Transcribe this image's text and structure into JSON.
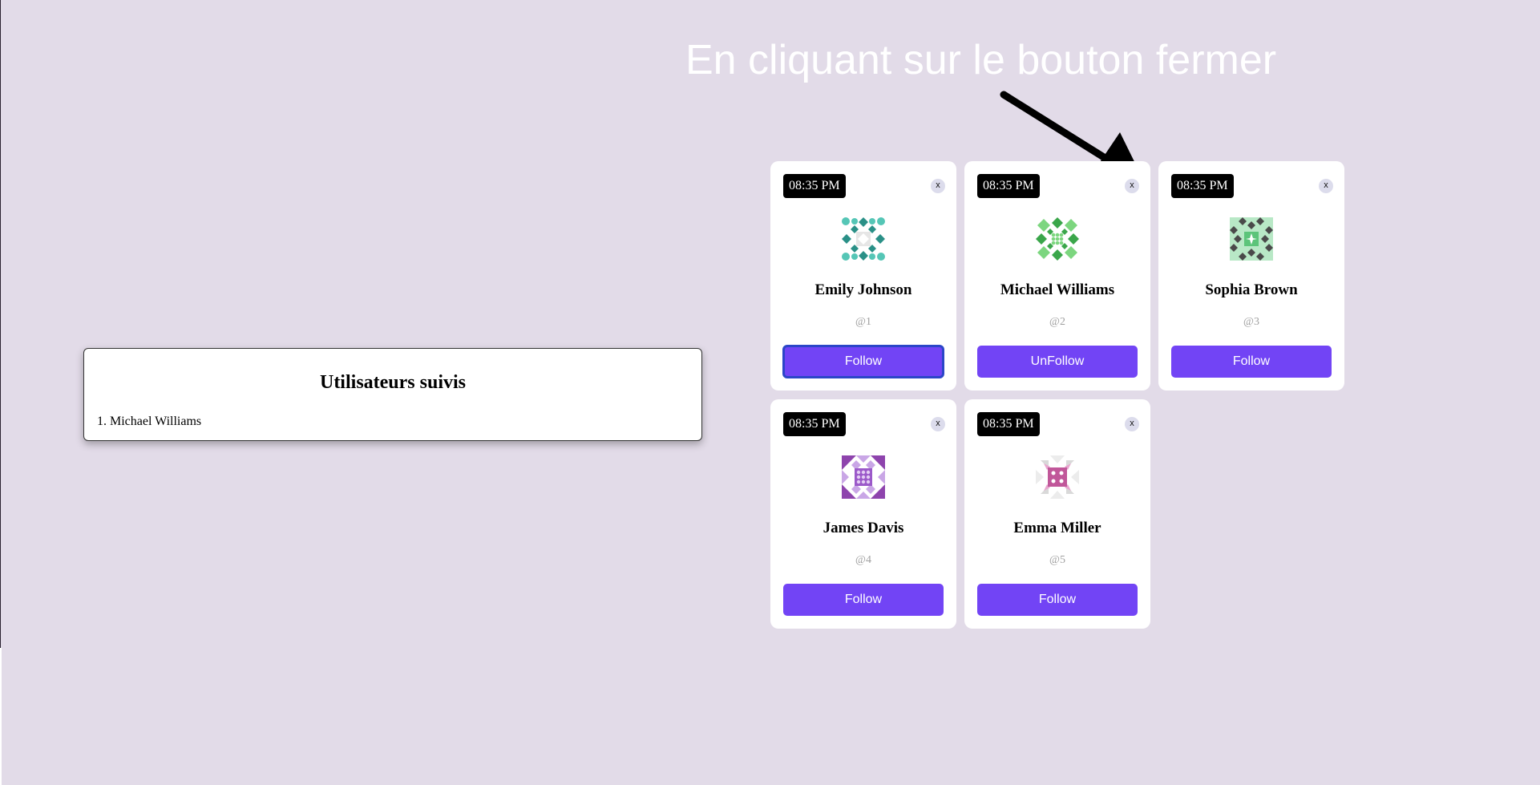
{
  "annotation": {
    "text": "En cliquant sur le bouton fermer"
  },
  "followed": {
    "title": "Utilisateurs suivis",
    "items": [
      "1. Michael Williams"
    ]
  },
  "cards": [
    {
      "time": "08:35 PM",
      "close": "x",
      "name": "Emily Johnson",
      "handle": "@1",
      "button": "Follow",
      "avatar": "teal-geometric-identicon"
    },
    {
      "time": "08:35 PM",
      "close": "x",
      "name": "Michael Williams",
      "handle": "@2",
      "button": "UnFollow",
      "avatar": "green-geometric-identicon"
    },
    {
      "time": "08:35 PM",
      "close": "x",
      "name": "Sophia Brown",
      "handle": "@3",
      "button": "Follow",
      "avatar": "gray-green-geometric-identicon"
    },
    {
      "time": "08:35 PM",
      "close": "x",
      "name": "James Davis",
      "handle": "@4",
      "button": "Follow",
      "avatar": "purple-geometric-identicon"
    },
    {
      "time": "08:35 PM",
      "close": "x",
      "name": "Emma Miller",
      "handle": "@5",
      "button": "Follow",
      "avatar": "pink-geometric-identicon"
    }
  ],
  "colors": {
    "background": "#e2dbe8",
    "button": "#7244f5",
    "badge": "#000000",
    "annotation": "#ffffff"
  }
}
